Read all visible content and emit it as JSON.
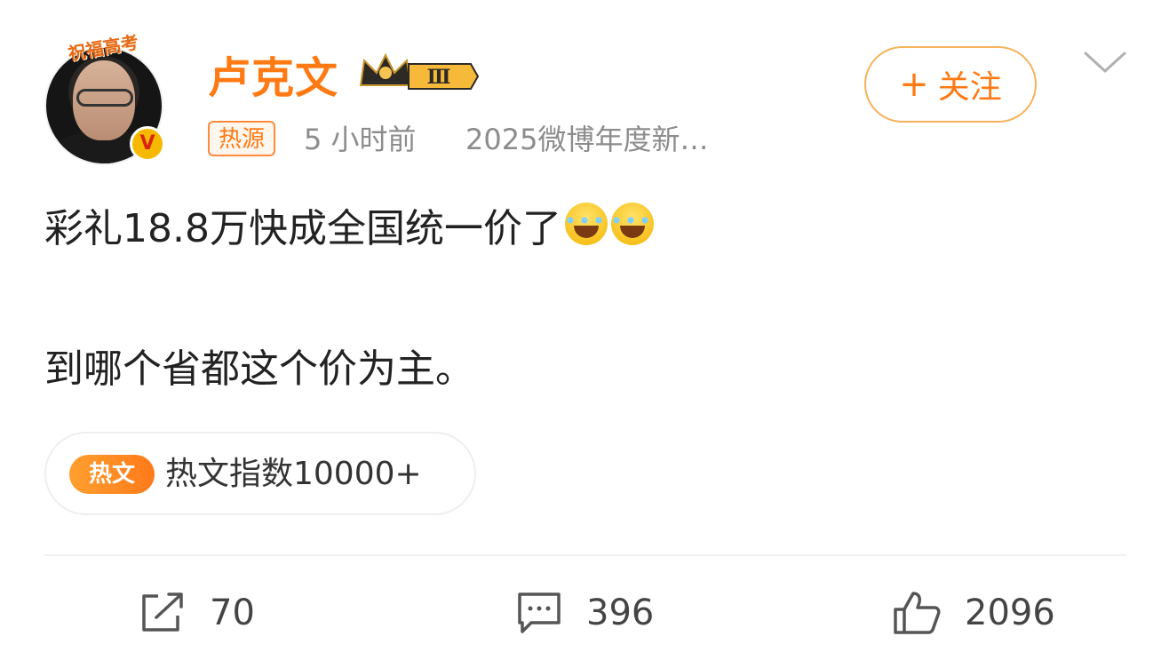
{
  "user": {
    "name": "卢克文",
    "badge_text": "祝福高考",
    "verified_icon": "V",
    "level_text": "Ⅲ"
  },
  "follow_button": {
    "plus": "+",
    "label": "关注"
  },
  "meta": {
    "source_tag": "热源",
    "time": "5 小时前",
    "title": "2025微博年度新…"
  },
  "post": {
    "line1": "彩礼18.8万快成全国统一价了",
    "line2": "到哪个省都这个价为主。",
    "emoji_icon": "laugh-cry-emoji-icon"
  },
  "hot": {
    "badge": "热文",
    "index_text": "热文指数10000+"
  },
  "actions": {
    "repost_count": "70",
    "comment_count": "396",
    "like_count": "2096"
  },
  "colors": {
    "brand_orange": "#ff7a14",
    "meta_gray": "#8c8c8c",
    "divider": "#f0f0f0"
  }
}
